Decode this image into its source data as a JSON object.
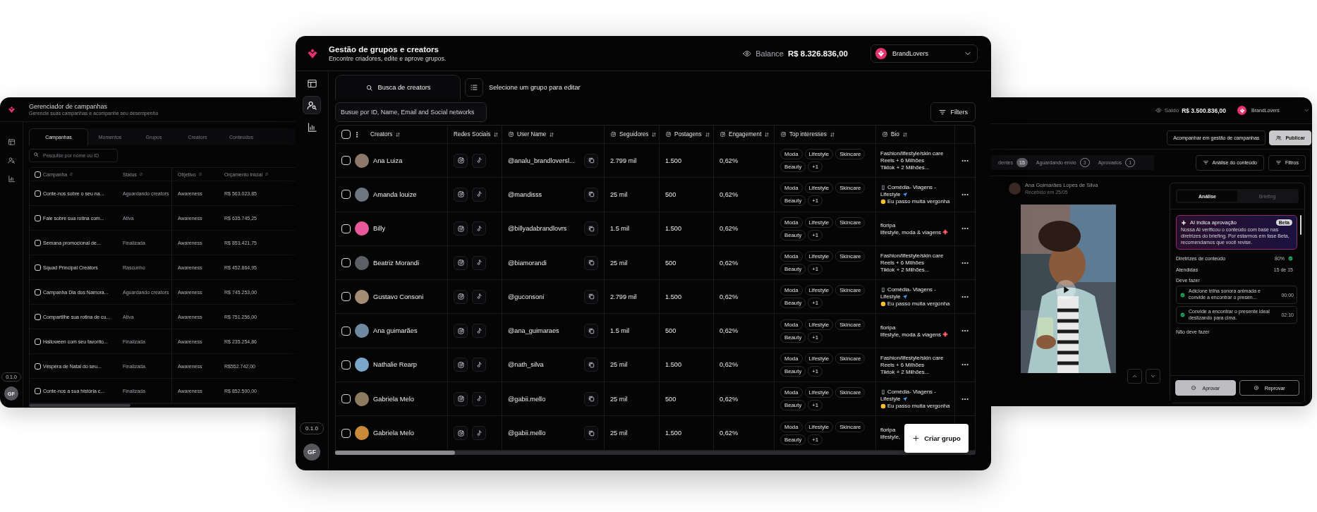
{
  "campaign_window": {
    "title": "Gerenciador de campanhas",
    "subtitle": "Gerencie suas campanhas e acompanhe seu desempenho",
    "nav": [
      {
        "kind": "table",
        "selected": false
      },
      {
        "kind": "users",
        "selected": false
      },
      {
        "kind": "chart",
        "selected": false
      }
    ],
    "tabs": [
      {
        "label": "Campanhas",
        "selected": true
      },
      {
        "label": "Momentos",
        "selected": false
      },
      {
        "label": "Grupos",
        "selected": false
      },
      {
        "label": "Creators",
        "selected": false
      },
      {
        "label": "Conteúdos",
        "selected": false
      }
    ],
    "search": {
      "placeholder": "Pesquise por nome ou ID"
    },
    "table": {
      "select_all": false,
      "columns": [
        "Campanha",
        "Status",
        "Objetivo",
        "Orçamento inicial"
      ],
      "rows": [
        {
          "checked": false,
          "cells": [
            "Conte-nos sobre o seu na...",
            "Aguardando creators",
            "Awareness",
            "R$ 563.023,85"
          ]
        },
        {
          "checked": false,
          "cells": [
            "Fale sobre sua rotina com...",
            "Ativa",
            "Awareness",
            "R$ 635.745,25"
          ]
        },
        {
          "checked": false,
          "cells": [
            "Semana promocional  de...",
            "Finalizada",
            "Awareness",
            "R$ 853.421,75"
          ]
        },
        {
          "checked": false,
          "cells": [
            "Squad Principal Creators",
            "Rascunho",
            "Awareness",
            "R$ 452.864,95"
          ]
        },
        {
          "checked": false,
          "cells": [
            "Campanha Dia dos Namora...",
            "Aguardando creators",
            "Awareness",
            "R$ 745.253,00"
          ]
        },
        {
          "checked": false,
          "cells": [
            "Compartilhe sua rotina de cu...",
            "Ativa",
            "Awareness",
            "R$ 751.256,00"
          ]
        },
        {
          "checked": false,
          "cells": [
            "Halloween com seu favorito...",
            "Finalizada",
            "Awareness",
            "R$ 235.254,86"
          ]
        },
        {
          "checked": false,
          "cells": [
            "Véspera de Natal do seu...",
            "Finalizada",
            "Awareness",
            "R$552.742,00"
          ]
        },
        {
          "checked": false,
          "cells": [
            "Conte-nos a sua história c...",
            "Finalizada",
            "Awareness",
            "R$ 852.500,00"
          ]
        }
      ]
    },
    "version": "0.1.0",
    "user_initials": "GF"
  },
  "groups_window": {
    "title": "Gestão de grupos e creators",
    "subtitle": "Encontre criadores, edite e aprove grupos.",
    "balance": {
      "label": "Balance",
      "value": "R$ 8.326.836,00"
    },
    "account": {
      "name": "BrandLovers"
    },
    "nav": [
      {
        "kind": "table",
        "selected": false
      },
      {
        "kind": "users",
        "selected": true
      },
      {
        "kind": "chart",
        "selected": false
      }
    ],
    "tabs": [
      {
        "label": "Busca de creators",
        "selected": true
      }
    ],
    "group_select": "Selecione um grupo para editar",
    "search": {
      "placeholder": "Busue por ID, Name, Email and Social networks"
    },
    "filters": "Filters",
    "table": {
      "select_all": false,
      "columns": [
        {
          "label": "Creators",
          "kind": "plain"
        },
        {
          "label": "Redes Sociais",
          "kind": "plain"
        },
        {
          "label": "User Name",
          "kind": "social"
        },
        {
          "label": "Seguidores",
          "kind": "social"
        },
        {
          "label": "Postagens",
          "kind": "social"
        },
        {
          "label": "Engagement",
          "kind": "social"
        },
        {
          "label": "Top interesses",
          "kind": "social"
        },
        {
          "label": "Bio",
          "kind": "social"
        }
      ],
      "rows": [
        {
          "checked": false,
          "menu": true,
          "name": "Ana Luiza",
          "handle": "@analu_brandloversl...",
          "followers": "2.799 mil",
          "posts": "1.500",
          "engagement": "0,62%",
          "interests": [
            "Moda",
            "Lifestyle",
            "Skincare",
            "Beauty"
          ],
          "more": "+1",
          "bio": {
            "kind": "plain",
            "lines": [
              "Fashion/lifestyle/skin care",
              "Reels + 6 Milhões",
              "Tiktok + 2 Milhões..."
            ]
          }
        },
        {
          "checked": false,
          "menu": true,
          "name": "Amanda louize",
          "handle": "@mandisss",
          "followers": "25 mil",
          "posts": "500",
          "engagement": "0,62%",
          "interests": [
            "Moda",
            "Lifestyle",
            "Skincare",
            "Beauty"
          ],
          "more": "+1",
          "bio": {
            "kind": "emoji",
            "lines": [
              "Comédia- Viagens -",
              "Lifestyle",
              "Eu passo muita vergonha"
            ]
          }
        },
        {
          "checked": false,
          "menu": true,
          "name": "Billy",
          "handle": "@billyadabrandlovrs",
          "followers": "1.5 mil",
          "posts": "1.500",
          "engagement": "0,62%",
          "interests": [
            "Moda",
            "Lifestyle",
            "Skincare",
            "Beauty"
          ],
          "more": "+1",
          "bio": {
            "kind": "floral",
            "lines": [
              "floripa",
              "lifestyle, moda & viagens"
            ]
          }
        },
        {
          "checked": false,
          "menu": true,
          "name": "Beatriz Morandi",
          "handle": "@biamorandi",
          "followers": "25 mil",
          "posts": "500",
          "engagement": "0,62%",
          "interests": [
            "Moda",
            "Lifestyle",
            "Skincare",
            "Beauty"
          ],
          "more": "+1",
          "bio": {
            "kind": "plain",
            "lines": [
              "Fashion/lifestyle/skin care",
              "Reels + 6 Milhões",
              "Tiktok + 2 Milhões..."
            ]
          }
        },
        {
          "checked": false,
          "menu": true,
          "name": "Gustavo Consoni",
          "handle": "@guconsoni",
          "followers": "2.799 mil",
          "posts": "1.500",
          "engagement": "0,62%",
          "interests": [
            "Moda",
            "Lifestyle",
            "Skincare",
            "Beauty"
          ],
          "more": "+1",
          "bio": {
            "kind": "emoji",
            "lines": [
              "Comédia- Viagens -",
              "Lifestyle",
              "Eu passo muita vergonha"
            ]
          }
        },
        {
          "checked": false,
          "menu": true,
          "name": "Ana guimarães",
          "handle": "@ana_guimaraes",
          "followers": "1.5 mil",
          "posts": "500",
          "engagement": "0,62%",
          "interests": [
            "Moda",
            "Lifestyle",
            "Skincare",
            "Beauty"
          ],
          "more": "+1",
          "bio": {
            "kind": "floral",
            "lines": [
              "floripa",
              "lifestyle, moda & viagens"
            ]
          }
        },
        {
          "checked": false,
          "menu": true,
          "name": "Nathalie Rearp",
          "handle": "@nath_silva",
          "followers": "25 mil",
          "posts": "1.500",
          "engagement": "0,62%",
          "interests": [
            "Moda",
            "Lifestyle",
            "Skincare",
            "Beauty"
          ],
          "more": "+1",
          "bio": {
            "kind": "plain",
            "lines": [
              "Fashion/lifestyle/skin care",
              "Reels + 6 Milhões",
              "Tiktok + 2 Milhões..."
            ]
          }
        },
        {
          "checked": false,
          "menu": true,
          "name": "Gabriela Melo",
          "handle": "@gabii.mello",
          "followers": "25 mil",
          "posts": "500",
          "engagement": "0,62%",
          "interests": [
            "Moda",
            "Lifestyle",
            "Skincare",
            "Beauty"
          ],
          "more": "+1",
          "bio": {
            "kind": "emoji",
            "lines": [
              "Comédia- Viagens -",
              "Lifestyle",
              "Eu passo muita vergonha"
            ]
          }
        },
        {
          "checked": false,
          "menu": false,
          "name": "Gabriela Melo",
          "handle": "@gabii.mello",
          "followers": "25 mil",
          "posts": "1.500",
          "engagement": "0,62%",
          "interests": [
            "Moda",
            "Lifestyle",
            "Skincare",
            "Beauty"
          ],
          "more": "+1",
          "bio": {
            "kind": "plain",
            "lines": [
              "floripa",
              "lifestyle,"
            ]
          }
        }
      ]
    },
    "create_button": "Criar grupo",
    "version": "0.1.0",
    "user_initials": "GF"
  },
  "review_window": {
    "balance": {
      "label": "Saldo",
      "value": "R$ 3.500.836,00"
    },
    "account": {
      "name": "BrandLovers"
    },
    "actions": [
      {
        "label": "Acompanhar em gestão de campanhas",
        "kind": "outline"
      },
      {
        "label": "Publicar",
        "kind": "primary"
      }
    ],
    "status_tabs": [
      {
        "label": "dentes",
        "count": "15",
        "selected": true
      },
      {
        "label": "Aguardando envio",
        "count": "3",
        "selected": false
      },
      {
        "label": "Aprovados",
        "count": "1",
        "selected": false
      }
    ],
    "tools": [
      "Análise do conteúdo",
      "Filtros"
    ],
    "submission": {
      "creator": "Ana Guimarães Lopes de Silva",
      "received": "Recebido em 25/05"
    },
    "panel": {
      "tabs": [
        {
          "label": "Análise",
          "selected": true
        },
        {
          "label": "Briefing",
          "selected": false
        }
      ],
      "ai": {
        "title": "AI indica aprovação",
        "badge": "Beta",
        "text": "Nossa AI verificou o conteúdo com base nas diretrizes do briefing. Por estarmos em fase Beta, recomendamos que você revise."
      },
      "metrics": [
        {
          "label": "Diretrizes de conteúdo",
          "value": "80%",
          "ok": true
        },
        {
          "label": "Atendidas",
          "value": "15 de 15",
          "ok": false
        }
      ],
      "sections": [
        {
          "title": "Deve fazer",
          "items": [
            {
              "text": "Adicione trilha sonora animada e convide a encontrar o presen...",
              "time": "00:00",
              "done": true
            },
            {
              "text": "Convide a encontrar o presente ideal deslizando para cima.",
              "time": "02:10",
              "done": true
            }
          ]
        },
        {
          "title": "Não deve fazer"
        }
      ],
      "decision": [
        {
          "label": "Aprovar",
          "kind": "primary"
        },
        {
          "label": "Reprovar",
          "kind": "outline"
        }
      ]
    }
  }
}
